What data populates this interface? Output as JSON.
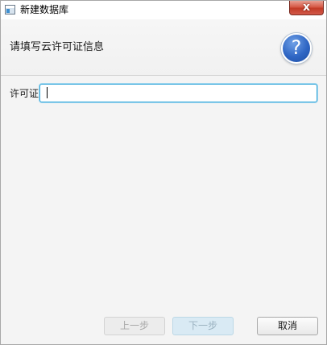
{
  "window": {
    "title": "新建数据库",
    "close_label": "x"
  },
  "header": {
    "title": "请填写云许可证信息",
    "help_glyph": "?",
    "help_icon": "help-icon"
  },
  "form": {
    "license_label": "许可证",
    "license_value": "",
    "license_placeholder": ""
  },
  "buttons": {
    "prev_label": "上一步",
    "next_label": "下一步",
    "cancel_label": "取消"
  },
  "colors": {
    "accent": "#39a8d9",
    "help_blue": "#2f66c4",
    "close_red": "#c23b26"
  }
}
